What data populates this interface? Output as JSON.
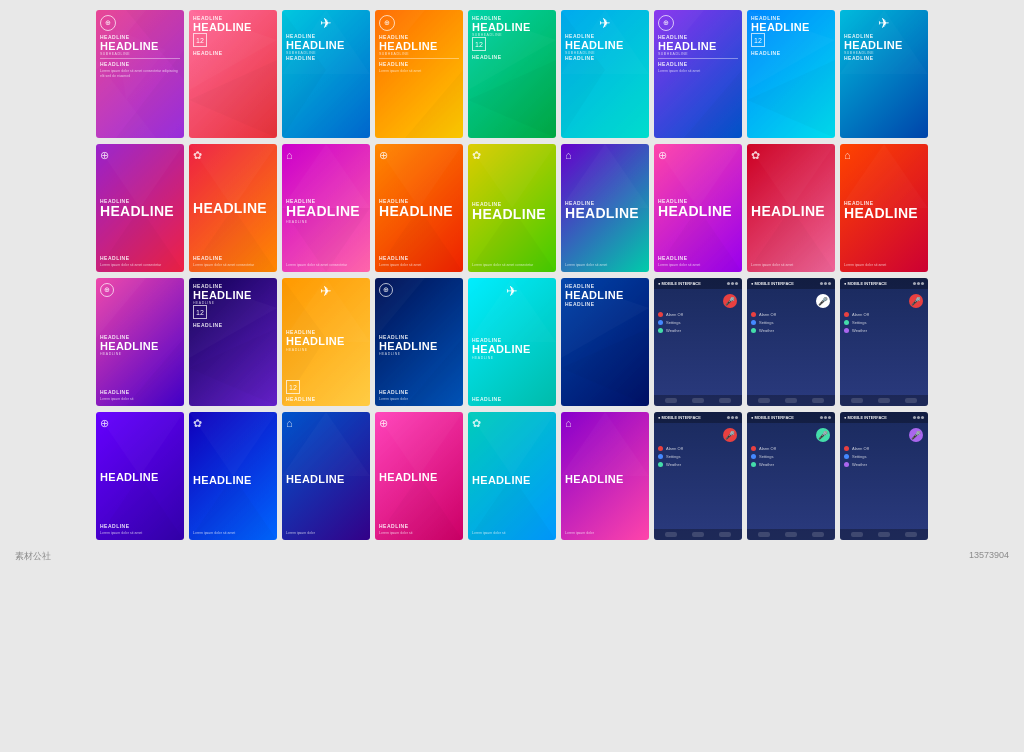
{
  "watermark": {
    "site": "素材公社",
    "code": "13573904"
  },
  "headline": "HEADLINE",
  "subheadline": "headLINe",
  "body_text": "Lorem ipsum dolor sit amet consectetur adipiscing elit sed do",
  "rows": [
    {
      "id": "row1",
      "cards": [
        {
          "id": "r1c1",
          "gradient": "grad-red-purple",
          "icon": "shield",
          "type": "brochure"
        },
        {
          "id": "r1c2",
          "gradient": "grad-pink-red",
          "icon": "gear",
          "type": "brochure"
        },
        {
          "id": "r1c3",
          "gradient": "grad-cyan-blue",
          "icon": "plane",
          "type": "brochure"
        },
        {
          "id": "r1c4",
          "gradient": "grad-orange-yellow",
          "icon": "shield",
          "type": "brochure"
        },
        {
          "id": "r1c5",
          "gradient": "grad-teal-green",
          "icon": "gear",
          "type": "brochure"
        },
        {
          "id": "r1c6",
          "gradient": "grad-blue-teal",
          "icon": "plane",
          "type": "brochure"
        },
        {
          "id": "r1c7",
          "gradient": "grad-purple-blue",
          "icon": "shield",
          "type": "brochure"
        },
        {
          "id": "r1c8",
          "gradient": "grad-blue-cyan",
          "icon": "gear",
          "type": "brochure"
        },
        {
          "id": "r1c9",
          "gradient": "grad-cyan-blue",
          "icon": "plane",
          "type": "brochure"
        }
      ]
    },
    {
      "id": "row2",
      "cards": [
        {
          "id": "r2c1",
          "gradient": "grad-purple-red",
          "icon": "globe",
          "type": "brochure2"
        },
        {
          "id": "r2c2",
          "gradient": "grad-red-orange",
          "icon": "sun",
          "type": "brochure2"
        },
        {
          "id": "r2c3",
          "gradient": "grad-magenta-pink",
          "icon": "home",
          "type": "brochure2"
        },
        {
          "id": "r2c4",
          "gradient": "grad-orange-red",
          "icon": "globe",
          "type": "brochure2"
        },
        {
          "id": "r2c5",
          "gradient": "grad-yellow-green",
          "icon": "sun",
          "type": "brochure2"
        },
        {
          "id": "r2c6",
          "gradient": "grad-purple-teal",
          "icon": "home",
          "type": "brochure2"
        },
        {
          "id": "r2c7",
          "gradient": "grad-pink-purple",
          "icon": "globe",
          "type": "brochure2"
        },
        {
          "id": "r2c8",
          "gradient": "grad-red-pink2",
          "icon": "sun",
          "type": "brochure2"
        },
        {
          "id": "r2c9",
          "gradient": "grad-orange-red",
          "icon": "home",
          "type": "brochure2"
        }
      ]
    },
    {
      "id": "row3",
      "cards": [
        {
          "id": "r3c1",
          "gradient": "grad-pink-blue",
          "icon": "shield",
          "type": "brochure3"
        },
        {
          "id": "r3c2",
          "gradient": "grad-navy-purple",
          "icon": "gear",
          "type": "brochure3"
        },
        {
          "id": "r3c3",
          "gradient": "grad-orange2",
          "icon": "plane",
          "type": "brochure3"
        },
        {
          "id": "r3c4",
          "gradient": "grad-navy-blue",
          "icon": "shield",
          "type": "brochure3"
        },
        {
          "id": "r3c5",
          "gradient": "grad-cyan-teal",
          "icon": "plane",
          "type": "brochure3"
        },
        {
          "id": "r3c6",
          "gradient": "grad-blue-navy",
          "icon": "gear",
          "type": "brochure3"
        },
        {
          "id": "r3c7",
          "gradient": "mobile",
          "icon": "mic",
          "type": "mobile"
        },
        {
          "id": "r3c8",
          "gradient": "mobile2",
          "icon": "mic",
          "type": "mobile"
        },
        {
          "id": "r3c9",
          "gradient": "mobile3",
          "icon": "mic",
          "type": "mobile"
        }
      ]
    },
    {
      "id": "row4",
      "cards": [
        {
          "id": "r4c1",
          "gradient": "grad-purple-indigo",
          "icon": "globe",
          "type": "brochure4"
        },
        {
          "id": "r4c2",
          "gradient": "grad-indigo-blue",
          "icon": "sun",
          "type": "brochure4"
        },
        {
          "id": "r4c3",
          "gradient": "grad-blue-indigo",
          "icon": "home",
          "type": "brochure4"
        },
        {
          "id": "r4c4",
          "gradient": "grad-pink-magenta",
          "icon": "globe",
          "type": "brochure4"
        },
        {
          "id": "r4c5",
          "gradient": "grad-teal-cyan",
          "icon": "sun",
          "type": "brochure4"
        },
        {
          "id": "r4c6",
          "gradient": "grad-purple-pink",
          "icon": "home",
          "type": "brochure4"
        },
        {
          "id": "r4c7",
          "gradient": "mobile4",
          "icon": "mic",
          "type": "mobile"
        },
        {
          "id": "r4c8",
          "gradient": "mobile5",
          "icon": "mic",
          "type": "mobile"
        },
        {
          "id": "r4c9",
          "gradient": "mobile6",
          "icon": "mic",
          "type": "mobile"
        }
      ]
    }
  ]
}
